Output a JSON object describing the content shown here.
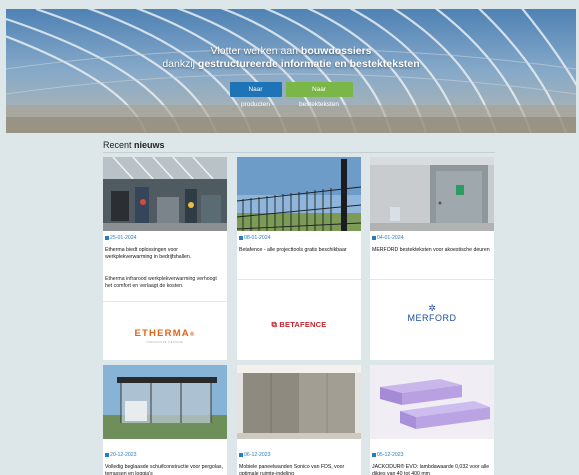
{
  "hero": {
    "line1_pre": "Vlotter werken aan ",
    "line1_bold": "bouwdossiers",
    "line2_pre": "dankzij ",
    "line2_bold": "gestructureerde informatie en bestekteksten",
    "btn_products": "Naar producten",
    "btn_specs": "Naar bestekteksten"
  },
  "news": {
    "title_pre": "Recent ",
    "title_bold": "nieuws",
    "cards": [
      {
        "date": "25-01-2024",
        "title": "Etherma biedt oplossingen voor werkplekverwarming in bedrijfshallen.",
        "desc": "Etherma infrarood werkplekverwarming verhoogt het comfort en verlaagt de kosten.",
        "logo": "ETHERMA",
        "logo_mark": "®",
        "logo_sub": "INNOVATIVE HEATING"
      },
      {
        "date": "08-01-2024",
        "title": "Betafence - alle projecttools gratis beschikbaar",
        "desc": "",
        "logo": "BETAFENCE",
        "logo_mark": "",
        "logo_sub": ""
      },
      {
        "date": "04-01-2024",
        "title": "MERFORD bestekteksten voor akoestische deuren",
        "desc": "",
        "logo": "MERFORD",
        "logo_mark": "",
        "logo_sub": ""
      },
      {
        "date": "20-12-2023",
        "title": "Volledig beglaasde schuifconstructie voor pergolas, terrassen en loggia's",
        "desc": ""
      },
      {
        "date": "06-12-2023",
        "title": "Mobiele paneelwanden Sonico van FDS, voor optimale ruimte-indeling",
        "desc": ""
      },
      {
        "date": "05-12-2023",
        "title": "JACKODUR® EVO: lambdawaarde 0,032 voor alle diktes van 40 tot 400 mm",
        "desc": ""
      }
    ]
  }
}
